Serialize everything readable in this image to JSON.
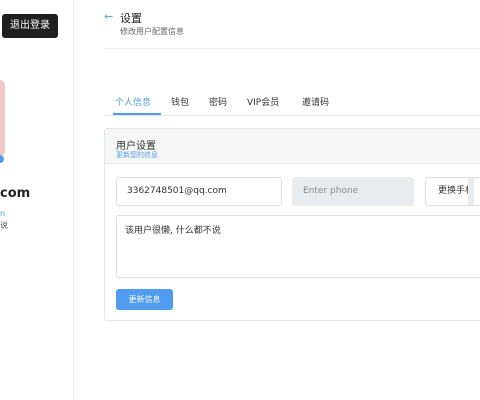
{
  "sidebar": {
    "logout_label": "退出登录",
    "email_tail": "com",
    "name_tail": "n",
    "bio_tail": "说"
  },
  "header": {
    "back_icon": "←",
    "title": "设置",
    "subtitle": "修改用户配置信息"
  },
  "tabs": [
    {
      "label": "个人信息",
      "active": true
    },
    {
      "label": "钱包",
      "active": false
    },
    {
      "label": "密码",
      "active": false
    },
    {
      "label": "VIP会员",
      "active": false
    },
    {
      "label": "邀请码",
      "active": false
    }
  ],
  "card": {
    "title": "用户设置",
    "subtitle": "更新您的信息",
    "email_value": "3362748501@qq.com",
    "phone_placeholder": "Enter phone",
    "change_phone_label": "更换手机",
    "bio_value": "该用户很懒, 什么都不说",
    "update_label": "更新信息"
  },
  "colors": {
    "accent": "#4f9cf0",
    "dark_button": "#1f1f1f"
  }
}
